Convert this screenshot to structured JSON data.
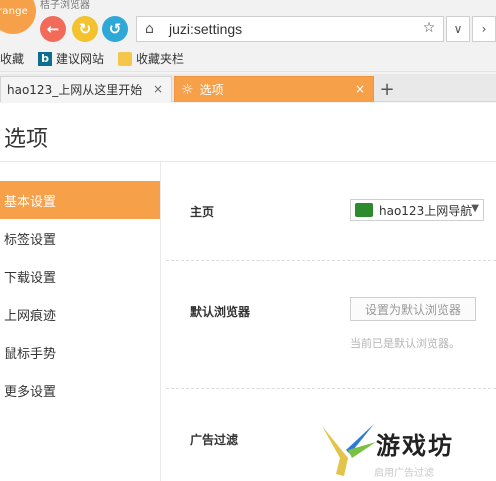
{
  "app": {
    "logo": "range",
    "top_text": "桔子浏览器"
  },
  "toolbar": {
    "url": "juzi:settings"
  },
  "bookmarks": {
    "favorites": "收藏",
    "suggested": "建议网站",
    "folder": "收藏夹栏"
  },
  "tabs": [
    {
      "label": "hao123_上网从这里开始"
    },
    {
      "label": "选项"
    }
  ],
  "page": {
    "title": "选项"
  },
  "sidebar": {
    "items": [
      {
        "label": "基本设置"
      },
      {
        "label": "标签设置"
      },
      {
        "label": "下载设置"
      },
      {
        "label": "上网痕迹"
      },
      {
        "label": "鼠标手势"
      },
      {
        "label": "更多设置"
      }
    ]
  },
  "settings": {
    "homepage_label": "主页",
    "homepage_value": "hao123上网导航",
    "default_browser_label": "默认浏览器",
    "default_browser_button": "设置为默认浏览器",
    "default_browser_hint": "当前已是默认浏览器。",
    "ad_filter_label": "广告过滤",
    "ad_filter_hint": "启用广告过滤"
  },
  "watermark": {
    "text": "游戏坊"
  },
  "colors": {
    "accent": "#f7a04a",
    "back": "#f26a5a",
    "refresh": "#f3c22e",
    "home": "#2ea8d7"
  }
}
